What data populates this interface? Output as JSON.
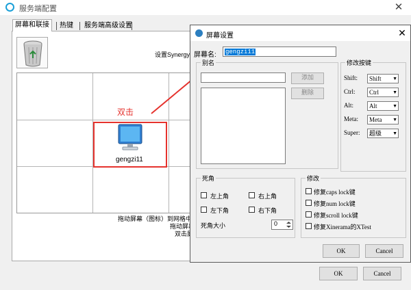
{
  "main": {
    "title": "服务端配置",
    "close": "✕",
    "tabs": [
      {
        "label": "屏幕和联接"
      },
      {
        "label": "热键"
      },
      {
        "label": "服务端高级设置"
      }
    ],
    "hint_top": "设置Synergy",
    "screen": {
      "name": "gengzi11"
    },
    "annotation": "双击",
    "hint_bottom": [
      "拖动屏幕（图标）到网格中",
      "拖动屏幕",
      "双击屏"
    ],
    "ok": "OK",
    "cancel": "Cancel"
  },
  "dialog": {
    "title": "屏幕设置",
    "close": "✕",
    "screen_name_label": "屏幕名:",
    "screen_name_value": "gengzi11",
    "aliases": {
      "title": "别名",
      "add": "添加",
      "delete": "删除"
    },
    "modifier_keys": {
      "title": "修改按键",
      "rows": [
        {
          "label": "Shift:",
          "value": "Shift"
        },
        {
          "label": "Ctrl:",
          "value": "Ctrl"
        },
        {
          "label": "Alt:",
          "value": "Alt"
        },
        {
          "label": "Meta:",
          "value": "Meta"
        },
        {
          "label": "Super:",
          "value": "超级"
        }
      ]
    },
    "dead_corners": {
      "title": "死角",
      "top_left": "左上角",
      "top_right": "右上角",
      "bottom_left": "左下角",
      "bottom_right": "右下角",
      "size_label": "死角大小",
      "size_value": "0"
    },
    "fixes": {
      "title": "修改",
      "items": [
        "修复caps lock键",
        "修复num lock键",
        "修复scroll lock键",
        "修复Xinerama的XTest"
      ]
    },
    "ok": "OK",
    "cancel": "Cancel"
  },
  "colors": {
    "accent": "#e5322d",
    "selection": "#0078d7"
  }
}
